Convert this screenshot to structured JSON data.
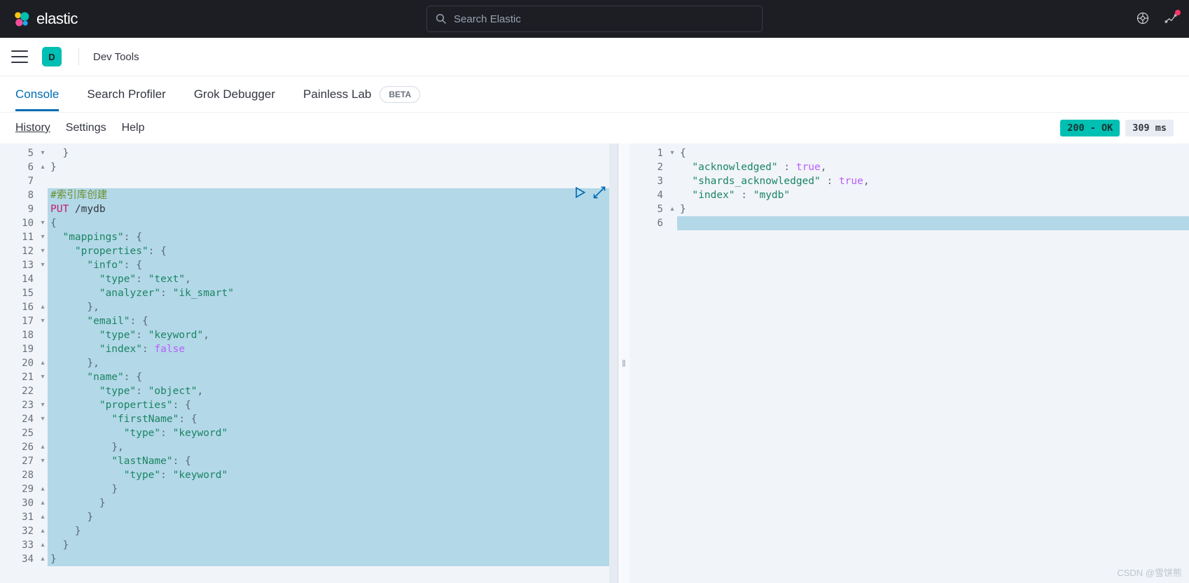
{
  "header": {
    "brand": "elastic",
    "search_placeholder": "Search Elastic"
  },
  "breadcrumb": {
    "space_letter": "D",
    "title": "Dev Tools"
  },
  "tabs": [
    {
      "label": "Console",
      "active": true
    },
    {
      "label": "Search Profiler",
      "active": false
    },
    {
      "label": "Grok Debugger",
      "active": false
    },
    {
      "label": "Painless Lab",
      "active": false,
      "badge": "BETA"
    }
  ],
  "subheader": {
    "links": [
      "History",
      "Settings",
      "Help"
    ],
    "status": "200 - OK",
    "timing": "309 ms"
  },
  "request": {
    "lines": [
      {
        "n": 5,
        "fold": "▾",
        "text": "  }"
      },
      {
        "n": 6,
        "fold": "▴",
        "text": "}"
      },
      {
        "n": 7,
        "fold": "",
        "text": ""
      },
      {
        "n": 8,
        "fold": "",
        "hl": true,
        "comment": "#索引库创建"
      },
      {
        "n": 9,
        "fold": "",
        "hl": true,
        "method": "PUT",
        "path": " /mydb"
      },
      {
        "n": 10,
        "fold": "▾",
        "hl": true,
        "json": [
          {
            "p": "{"
          }
        ]
      },
      {
        "n": 11,
        "fold": "▾",
        "hl": true,
        "json": [
          {
            "t": "  "
          },
          {
            "k": "\"mappings\""
          },
          {
            "p": ": {"
          }
        ]
      },
      {
        "n": 12,
        "fold": "▾",
        "hl": true,
        "json": [
          {
            "t": "    "
          },
          {
            "k": "\"properties\""
          },
          {
            "p": ": {"
          }
        ]
      },
      {
        "n": 13,
        "fold": "▾",
        "hl": true,
        "json": [
          {
            "t": "      "
          },
          {
            "k": "\"info\""
          },
          {
            "p": ": {"
          }
        ]
      },
      {
        "n": 14,
        "fold": "",
        "hl": true,
        "json": [
          {
            "t": "        "
          },
          {
            "k": "\"type\""
          },
          {
            "p": ": "
          },
          {
            "s": "\"text\""
          },
          {
            "p": ","
          }
        ]
      },
      {
        "n": 15,
        "fold": "",
        "hl": true,
        "json": [
          {
            "t": "        "
          },
          {
            "k": "\"analyzer\""
          },
          {
            "p": ": "
          },
          {
            "s": "\"ik_smart\""
          }
        ]
      },
      {
        "n": 16,
        "fold": "▴",
        "hl": true,
        "json": [
          {
            "t": "      "
          },
          {
            "p": "},"
          }
        ]
      },
      {
        "n": 17,
        "fold": "▾",
        "hl": true,
        "json": [
          {
            "t": "      "
          },
          {
            "k": "\"email\""
          },
          {
            "p": ": {"
          }
        ]
      },
      {
        "n": 18,
        "fold": "",
        "hl": true,
        "json": [
          {
            "t": "        "
          },
          {
            "k": "\"type\""
          },
          {
            "p": ": "
          },
          {
            "s": "\"keyword\""
          },
          {
            "p": ","
          }
        ]
      },
      {
        "n": 19,
        "fold": "",
        "hl": true,
        "json": [
          {
            "t": "        "
          },
          {
            "k": "\"index\""
          },
          {
            "p": ": "
          },
          {
            "b": "false"
          }
        ]
      },
      {
        "n": 20,
        "fold": "▴",
        "hl": true,
        "json": [
          {
            "t": "      "
          },
          {
            "p": "},"
          }
        ]
      },
      {
        "n": 21,
        "fold": "▾",
        "hl": true,
        "json": [
          {
            "t": "      "
          },
          {
            "k": "\"name\""
          },
          {
            "p": ": {"
          }
        ]
      },
      {
        "n": 22,
        "fold": "",
        "hl": true,
        "json": [
          {
            "t": "        "
          },
          {
            "k": "\"type\""
          },
          {
            "p": ": "
          },
          {
            "s": "\"object\""
          },
          {
            "p": ","
          }
        ]
      },
      {
        "n": 23,
        "fold": "▾",
        "hl": true,
        "json": [
          {
            "t": "        "
          },
          {
            "k": "\"properties\""
          },
          {
            "p": ": {"
          }
        ]
      },
      {
        "n": 24,
        "fold": "▾",
        "hl": true,
        "json": [
          {
            "t": "          "
          },
          {
            "k": "\"firstName\""
          },
          {
            "p": ": {"
          }
        ]
      },
      {
        "n": 25,
        "fold": "",
        "hl": true,
        "json": [
          {
            "t": "            "
          },
          {
            "k": "\"type\""
          },
          {
            "p": ": "
          },
          {
            "s": "\"keyword\""
          }
        ]
      },
      {
        "n": 26,
        "fold": "▴",
        "hl": true,
        "json": [
          {
            "t": "          "
          },
          {
            "p": "},"
          }
        ]
      },
      {
        "n": 27,
        "fold": "▾",
        "hl": true,
        "json": [
          {
            "t": "          "
          },
          {
            "k": "\"lastName\""
          },
          {
            "p": ": {"
          }
        ]
      },
      {
        "n": 28,
        "fold": "",
        "hl": true,
        "json": [
          {
            "t": "            "
          },
          {
            "k": "\"type\""
          },
          {
            "p": ": "
          },
          {
            "s": "\"keyword\""
          }
        ]
      },
      {
        "n": 29,
        "fold": "▴",
        "hl": true,
        "json": [
          {
            "t": "          "
          },
          {
            "p": "}"
          }
        ]
      },
      {
        "n": 30,
        "fold": "▴",
        "hl": true,
        "json": [
          {
            "t": "        "
          },
          {
            "p": "}"
          }
        ]
      },
      {
        "n": 31,
        "fold": "▴",
        "hl": true,
        "json": [
          {
            "t": "      "
          },
          {
            "p": "}"
          }
        ]
      },
      {
        "n": 32,
        "fold": "▴",
        "hl": true,
        "json": [
          {
            "t": "    "
          },
          {
            "p": "}"
          }
        ]
      },
      {
        "n": 33,
        "fold": "▴",
        "hl": true,
        "json": [
          {
            "t": "  "
          },
          {
            "p": "}"
          }
        ]
      },
      {
        "n": 34,
        "fold": "▴",
        "hl": true,
        "json": [
          {
            "p": "}"
          }
        ]
      }
    ]
  },
  "response": {
    "lines": [
      {
        "n": 1,
        "fold": "▾",
        "json": [
          {
            "p": "{"
          }
        ]
      },
      {
        "n": 2,
        "fold": "",
        "json": [
          {
            "t": "  "
          },
          {
            "k": "\"acknowledged\""
          },
          {
            "p": " : "
          },
          {
            "b": "true"
          },
          {
            "p": ","
          }
        ]
      },
      {
        "n": 3,
        "fold": "",
        "json": [
          {
            "t": "  "
          },
          {
            "k": "\"shards_acknowledged\""
          },
          {
            "p": " : "
          },
          {
            "b": "true"
          },
          {
            "p": ","
          }
        ]
      },
      {
        "n": 4,
        "fold": "",
        "json": [
          {
            "t": "  "
          },
          {
            "k": "\"index\""
          },
          {
            "p": " : "
          },
          {
            "s": "\"mydb\""
          }
        ]
      },
      {
        "n": 5,
        "fold": "▴",
        "json": [
          {
            "p": "}"
          }
        ]
      },
      {
        "n": 6,
        "fold": "",
        "hl": true,
        "json": []
      }
    ]
  },
  "watermark": "CSDN @雪饼熊"
}
